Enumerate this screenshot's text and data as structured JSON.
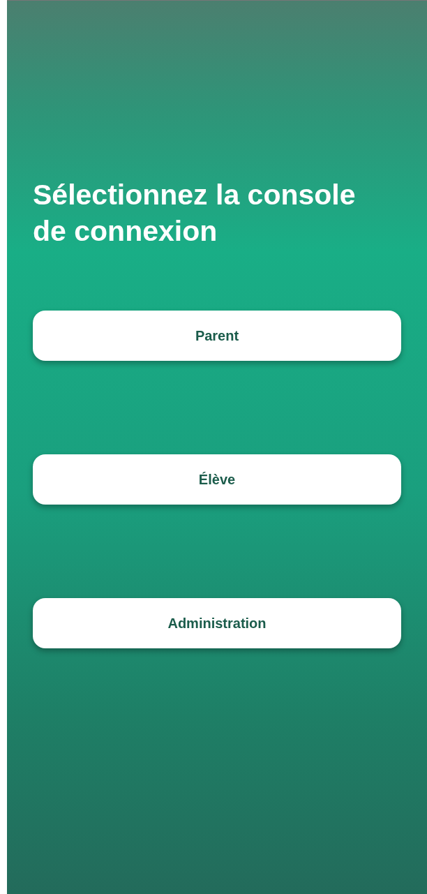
{
  "title": "Sélectionnez la console de connexion",
  "options": [
    {
      "label": "Parent"
    },
    {
      "label": "Élève"
    },
    {
      "label": "Administration"
    }
  ]
}
